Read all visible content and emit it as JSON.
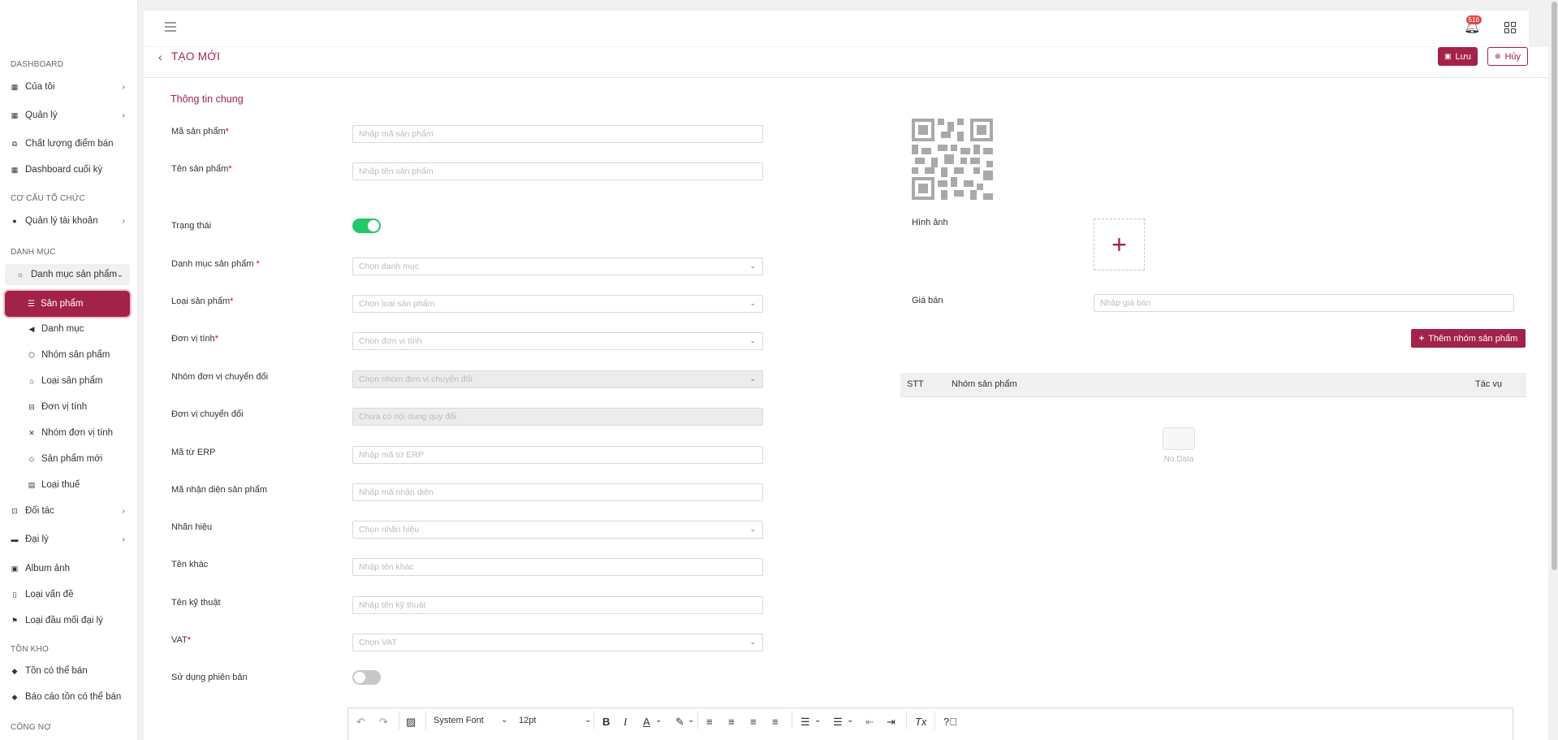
{
  "sidebar": {
    "sections": {
      "dashboard": "DASHBOARD",
      "org": "CƠ CẤU TỔ CHỨC",
      "catalog": "DANH MỤC",
      "stock": "TỒN KHO",
      "debt": "CÔNG NỢ"
    },
    "items": {
      "cua_toi": "Của tôi",
      "quan_ly": "Quản lý",
      "chat_luong": "Chất lượng điểm bán",
      "dashboard_cuoi_ky": "Dashboard cuối kỳ",
      "quan_ly_tai_khoan": "Quản lý tài khoản",
      "danh_muc_san_pham": "Danh mục sản phẩm",
      "san_pham": "Sản phẩm",
      "danh_muc": "Danh mục",
      "nhom_san_pham": "Nhóm sản phẩm",
      "loai_san_pham": "Loại sản phẩm",
      "don_vi_tinh": "Đơn vị tính",
      "nhom_don_vi_tinh": "Nhóm đơn vị tính",
      "san_pham_moi": "Sản phẩm mới",
      "loai_thue": "Loại thuế",
      "doi_tac": "Đối tác",
      "dai_ly": "Đại lý",
      "album_anh": "Album ảnh",
      "loai_van_de": "Loại vấn đề",
      "loai_dau_moi": "Loại đầu mối đại lý",
      "ton_co_the_ban": "Tồn có thể bán",
      "bao_cao_ton": "Báo cáo tồn có thể bán"
    }
  },
  "topbar": {
    "notification_count": "516"
  },
  "header": {
    "title": "TẠO MỚI",
    "save_label": "Lưu",
    "cancel_label": "Hủy"
  },
  "form": {
    "section_title": "Thông tin chung",
    "fields": {
      "ma_san_pham": {
        "label": "Mã sản phẩm",
        "placeholder": "Nhập mã sản phẩm"
      },
      "ten_san_pham": {
        "label": "Tên sản phẩm",
        "placeholder": "Nhập tên sản phẩm"
      },
      "trang_thai": {
        "label": "Trạng thái",
        "value": true
      },
      "danh_muc": {
        "label": "Danh mục sản phẩm",
        "placeholder": "Chọn danh mục"
      },
      "loai": {
        "label": "Loại sản phẩm",
        "placeholder": "Chọn loại sản phẩm"
      },
      "don_vi_tinh": {
        "label": "Đơn vị tính",
        "placeholder": "Chọn đơn vị tính"
      },
      "nhom_don_vi": {
        "label": "Nhóm đơn vị chuyển đổi",
        "placeholder": "Chọn nhóm đơn vị chuyển đổi"
      },
      "don_vi_chuyen_doi": {
        "label": "Đơn vị chuyển đổi",
        "placeholder": "Chưa có nội dung quy đổi"
      },
      "ma_erp": {
        "label": "Mã từ ERP",
        "placeholder": "Nhập mã từ ERP"
      },
      "ma_nhan_dien": {
        "label": "Mã nhận diện sản phẩm",
        "placeholder": "Nhập mã nhận diện"
      },
      "nhan_hieu": {
        "label": "Nhãn hiệu",
        "placeholder": "Chọn nhãn hiệu"
      },
      "ten_khac": {
        "label": "Tên khác",
        "placeholder": "Nhập tên khác"
      },
      "ten_ky_thuat": {
        "label": "Tên kỹ thuật",
        "placeholder": "Nhập tên kỹ thuật"
      },
      "vat": {
        "label": "VAT",
        "placeholder": "Chọn VAT"
      },
      "su_dung_phien_ban": {
        "label": "Sử dụng phiên bản",
        "value": false
      }
    },
    "right": {
      "hinh_anh_label": "Hình ảnh",
      "gia_ban_label": "Giá bán",
      "gia_ban_placeholder": "Nhập giá bán",
      "add_group_label": "Thêm nhóm sản phẩm",
      "table_headers": [
        "STT",
        "Nhóm sản phẩm",
        "Tác vụ"
      ],
      "empty_text": "No Data"
    }
  },
  "editor": {
    "font": "System Font",
    "size": "12pt"
  },
  "colors": {
    "primary": "#a3224a",
    "toggle_on": "#24c76a"
  }
}
